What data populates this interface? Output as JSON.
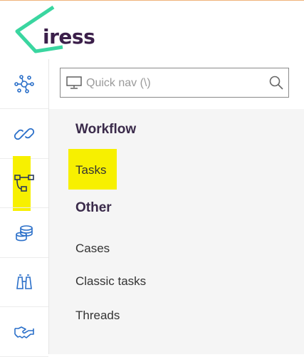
{
  "brand": {
    "name": "iress",
    "accent": "#3ad6a0",
    "text_color": "#3b1f4a"
  },
  "rail": {
    "items": [
      {
        "icon": "network-icon",
        "label": ""
      },
      {
        "icon": "link-icon",
        "label": ""
      },
      {
        "icon": "workflow-icon",
        "label": "",
        "active": true
      },
      {
        "icon": "database-icon",
        "label": ""
      },
      {
        "icon": "binoculars-icon",
        "label": ""
      },
      {
        "icon": "handshake-icon",
        "label": ""
      }
    ],
    "icon_color": "#2a6fc9"
  },
  "search": {
    "placeholder": "Quick nav (\\)"
  },
  "menu": {
    "sections": [
      {
        "title": "Workflow",
        "items": [
          "Tasks"
        ]
      },
      {
        "title": "Other",
        "items": [
          "Cases",
          "Classic tasks",
          "Threads"
        ]
      }
    ]
  },
  "highlight_color": "#f7f000"
}
